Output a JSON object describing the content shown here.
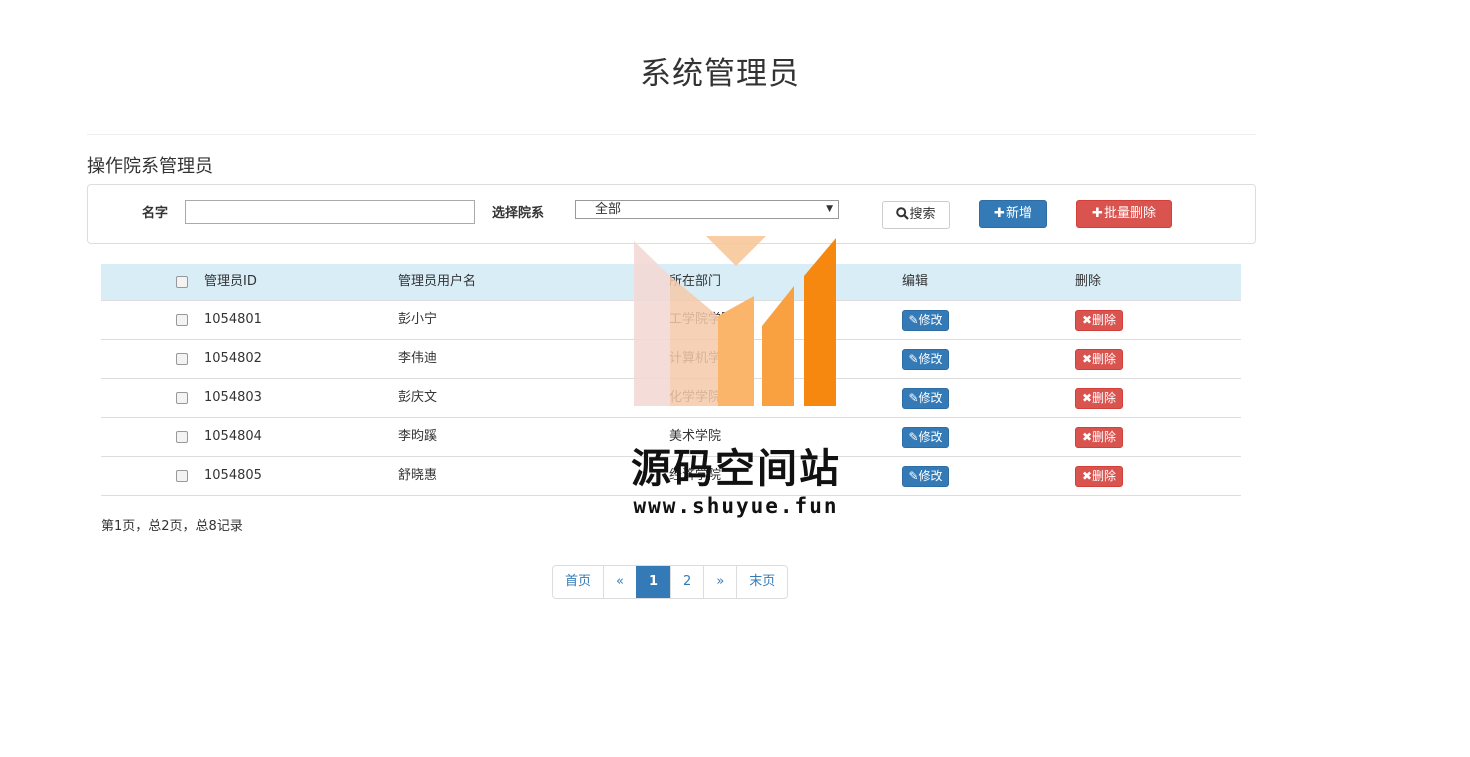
{
  "page": {
    "title": "系统管理员"
  },
  "section": {
    "title": "操作院系管理员"
  },
  "filter": {
    "name_label": "名字",
    "name_value": "",
    "dept_label": "选择院系",
    "dept_selected": "全部",
    "search_label": "搜索",
    "add_label": "新增",
    "batch_delete_label": "批量删除"
  },
  "table": {
    "headers": [
      "管理员ID",
      "管理员用户名",
      "所在部门",
      "编辑",
      "删除"
    ],
    "rows": [
      {
        "id": "1054801",
        "username": "彭小宁",
        "dept": "工学院学院",
        "edit": "修改",
        "delete": "删除"
      },
      {
        "id": "1054802",
        "username": "李伟迪",
        "dept": "计算机学院",
        "edit": "修改",
        "delete": "删除"
      },
      {
        "id": "1054803",
        "username": "彭庆文",
        "dept": "化学学院",
        "edit": "修改",
        "delete": "删除"
      },
      {
        "id": "1054804",
        "username": "李昀蹊",
        "dept": "美术学院",
        "edit": "修改",
        "delete": "删除"
      },
      {
        "id": "1054805",
        "username": "舒晓惠",
        "dept": "经济学院",
        "edit": "修改",
        "delete": "删除"
      }
    ]
  },
  "record_info": "第1页，总2页，总8记录",
  "pagination": {
    "first": "首页",
    "prev": "«",
    "pages": [
      "1",
      "2"
    ],
    "current": "1",
    "next": "»",
    "last": "末页"
  },
  "watermark": {
    "title": "源码空间站",
    "url": "www.shuyue.fun"
  },
  "colors": {
    "primary": "#337ab7",
    "danger": "#d9534f",
    "header_bg": "#d9edf7",
    "watermark_orange": "#f7880f",
    "watermark_pink": "#f3d8d4"
  }
}
